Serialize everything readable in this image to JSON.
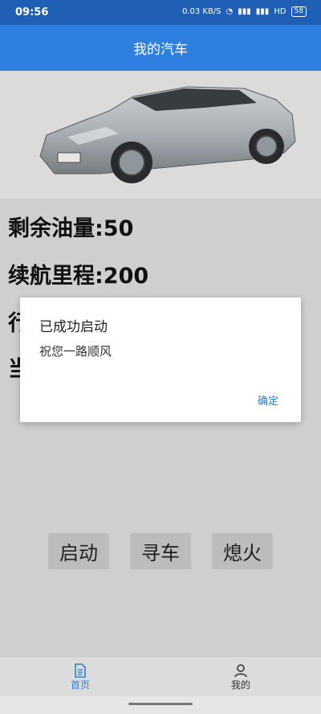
{
  "status": {
    "time": "09:56",
    "network_speed": "0.03 KB/S",
    "wifi": "wifi-icon",
    "signal1": "signal-icon",
    "signal2": "signal-icon",
    "hd": "HD",
    "battery": "58"
  },
  "appbar": {
    "title": "我的汽车"
  },
  "stats": {
    "fuel": "剩余油量:50",
    "range": "续航里程:200",
    "line3_partial": "行",
    "line4_partial": "当"
  },
  "dialog": {
    "title": "已成功启动",
    "message": "祝您一路顺风",
    "ok": "确定"
  },
  "actions": {
    "start": "启动",
    "find": "寻车",
    "stop": "熄火"
  },
  "nav": {
    "home": "首页",
    "me": "我的"
  },
  "colors": {
    "primary": "#2f7fe0",
    "statusbar": "#1f5fb5",
    "link": "#1f7fd1"
  }
}
